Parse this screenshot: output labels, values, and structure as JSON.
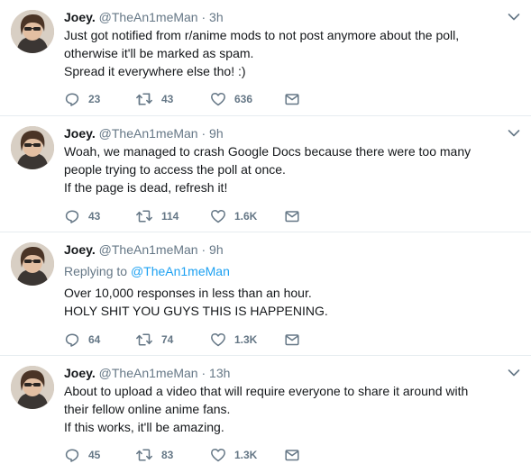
{
  "tweets": [
    {
      "name": "Joey.",
      "handle": "@TheAn1meMan",
      "separator": "·",
      "time": "3h",
      "replying_label": "",
      "replying_to": "",
      "lines": [
        "Just got notified from r/anime mods to not post anymore about the poll,",
        "otherwise it'll be marked as spam.",
        "Spread it everywhere else tho! :)"
      ],
      "replies": "23",
      "retweets": "43",
      "likes": "636"
    },
    {
      "name": "Joey.",
      "handle": "@TheAn1meMan",
      "separator": "·",
      "time": "9h",
      "replying_label": "",
      "replying_to": "",
      "lines": [
        "Woah, we managed to crash Google Docs because there were too many",
        "people trying to access the poll at once.",
        "If the page is dead, refresh it!"
      ],
      "replies": "43",
      "retweets": "114",
      "likes": "1.6K"
    },
    {
      "name": "Joey.",
      "handle": "@TheAn1meMan",
      "separator": "·",
      "time": "9h",
      "replying_label": "Replying to",
      "replying_to": "@TheAn1meMan",
      "lines": [
        "Over 10,000 responses in less than an hour.",
        "HOLY SHIT YOU GUYS THIS IS HAPPENING."
      ],
      "replies": "64",
      "retweets": "74",
      "likes": "1.3K"
    },
    {
      "name": "Joey.",
      "handle": "@TheAn1meMan",
      "separator": "·",
      "time": "13h",
      "replying_label": "",
      "replying_to": "",
      "lines": [
        "About to upload a video that will require everyone to share it around with",
        "their fellow online anime fans.",
        "If this works, it'll be amazing."
      ],
      "replies": "45",
      "retweets": "83",
      "likes": "1.3K"
    }
  ],
  "colors": {
    "text": "#14171a",
    "muted": "#657786",
    "link": "#1da1f2",
    "divider": "#e6ecf0"
  },
  "icons": [
    "reply-icon",
    "retweet-icon",
    "like-icon",
    "direct-message-icon",
    "chevron-down-icon"
  ]
}
